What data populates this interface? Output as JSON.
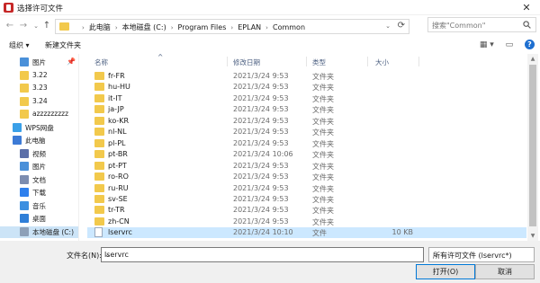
{
  "window": {
    "title": "选择许可文件",
    "close": "✕"
  },
  "nav": {
    "back": "←",
    "forward": "→",
    "history": "⌄",
    "up": "↑",
    "breadcrumb": [
      "此电脑",
      "本地磁盘 (C:)",
      "Program Files",
      "EPLAN",
      "Common"
    ],
    "breadcrumb_sep": "›",
    "search_placeholder": "搜索\"Common\""
  },
  "toolbar": {
    "organize": "组织 ▾",
    "new_folder": "新建文件夹",
    "view": "▦ ▾",
    "pane": "▭",
    "help": "?"
  },
  "sidebar": [
    {
      "label": "图片",
      "icon": "pictures-icon",
      "pinned": true
    },
    {
      "label": "3.22",
      "icon": "folder-icon"
    },
    {
      "label": "3.23",
      "icon": "folder-icon"
    },
    {
      "label": "3.24",
      "icon": "folder-icon"
    },
    {
      "label": "azzzzzzzzz",
      "icon": "folder-icon"
    },
    {
      "label": "WPS网盘",
      "icon": "cloud-icon"
    },
    {
      "label": "此电脑",
      "icon": "computer-icon"
    },
    {
      "label": "视频",
      "icon": "video-icon"
    },
    {
      "label": "图片",
      "icon": "pictures-icon"
    },
    {
      "label": "文档",
      "icon": "documents-icon"
    },
    {
      "label": "下载",
      "icon": "download-icon"
    },
    {
      "label": "音乐",
      "icon": "music-icon"
    },
    {
      "label": "桌面",
      "icon": "desktop-icon"
    },
    {
      "label": "本地磁盘 (C:)",
      "icon": "drive-icon",
      "selected": true
    }
  ],
  "columns": {
    "name": "名称",
    "date": "修改日期",
    "type": "类型",
    "size": "大小",
    "pin": "📌",
    "sort": "^"
  },
  "files": [
    {
      "name": "fr-FR",
      "date": "2021/3/24 9:53",
      "type": "文件夹",
      "size": ""
    },
    {
      "name": "hu-HU",
      "date": "2021/3/24 9:53",
      "type": "文件夹",
      "size": ""
    },
    {
      "name": "it-IT",
      "date": "2021/3/24 9:53",
      "type": "文件夹",
      "size": ""
    },
    {
      "name": "ja-JP",
      "date": "2021/3/24 9:53",
      "type": "文件夹",
      "size": ""
    },
    {
      "name": "ko-KR",
      "date": "2021/3/24 9:53",
      "type": "文件夹",
      "size": ""
    },
    {
      "name": "nl-NL",
      "date": "2021/3/24 9:53",
      "type": "文件夹",
      "size": ""
    },
    {
      "name": "pl-PL",
      "date": "2021/3/24 9:53",
      "type": "文件夹",
      "size": ""
    },
    {
      "name": "pt-BR",
      "date": "2021/3/24 10:06",
      "type": "文件夹",
      "size": ""
    },
    {
      "name": "pt-PT",
      "date": "2021/3/24 9:53",
      "type": "文件夹",
      "size": ""
    },
    {
      "name": "ro-RO",
      "date": "2021/3/24 9:53",
      "type": "文件夹",
      "size": ""
    },
    {
      "name": "ru-RU",
      "date": "2021/3/24 9:53",
      "type": "文件夹",
      "size": ""
    },
    {
      "name": "sv-SE",
      "date": "2021/3/24 9:53",
      "type": "文件夹",
      "size": ""
    },
    {
      "name": "tr-TR",
      "date": "2021/3/24 9:53",
      "type": "文件夹",
      "size": ""
    },
    {
      "name": "zh-CN",
      "date": "2021/3/24 9:53",
      "type": "文件夹",
      "size": ""
    },
    {
      "name": "lservrc",
      "date": "2021/3/24 10:10",
      "type": "文件",
      "size": "10 KB",
      "selected": true,
      "icon": "file-icon"
    }
  ],
  "bottom": {
    "filename_label": "文件名(N):",
    "filename_value": "lservrc",
    "filetype_value": "所有许可文件 (lservrc*)",
    "dropdown": "⌄",
    "open": "打开(O)",
    "cancel": "取消"
  },
  "colors": {
    "selection": "#cce8ff",
    "folder": "#f2c94c",
    "accent": "#0078d7"
  }
}
